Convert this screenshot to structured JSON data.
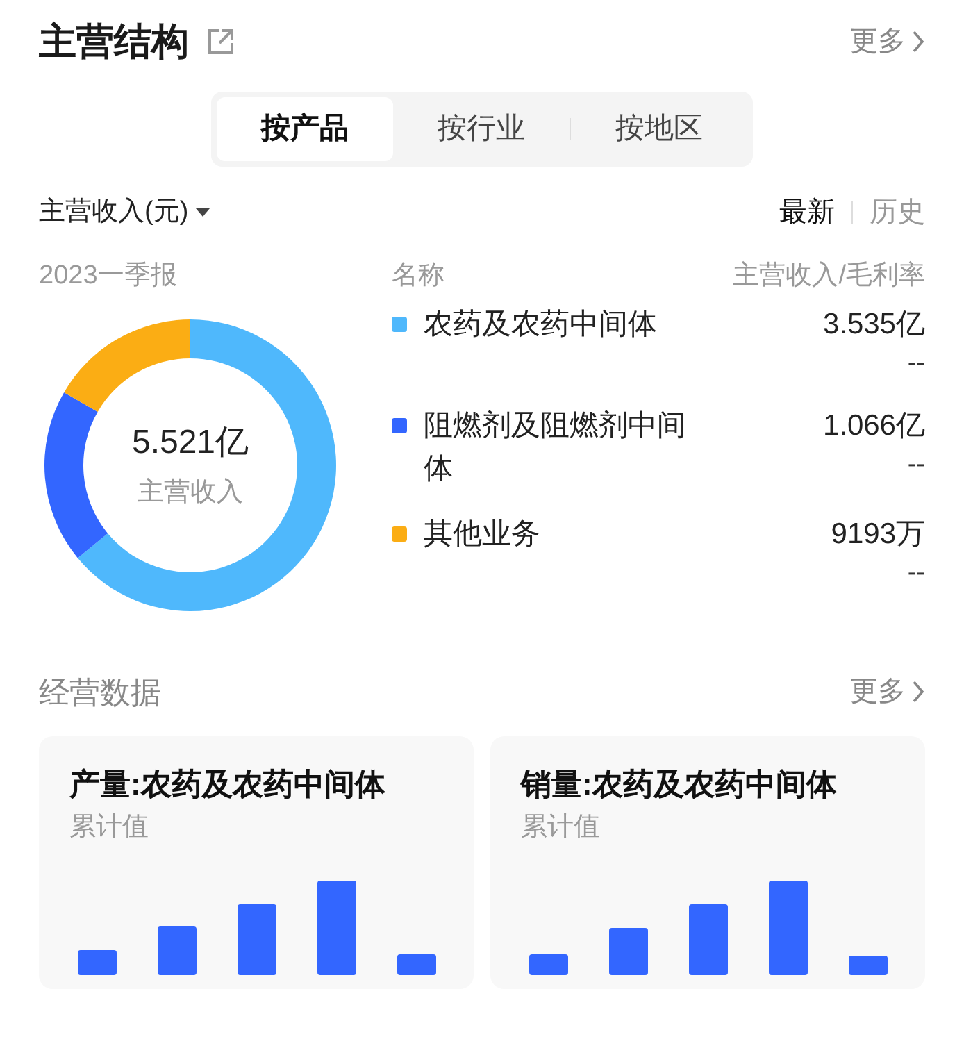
{
  "header": {
    "title": "主营结构",
    "more": "更多"
  },
  "tabs": [
    {
      "label": "按产品",
      "selected": true
    },
    {
      "label": "按行业",
      "selected": false
    },
    {
      "label": "按地区",
      "selected": false
    }
  ],
  "metric_dropdown": "主营收入(元)",
  "period_toggle": [
    {
      "label": "最新",
      "selected": true
    },
    {
      "label": "历史",
      "selected": false
    }
  ],
  "column_headers": {
    "period": "2023一季报",
    "name": "名称",
    "value": "主营收入/毛利率"
  },
  "donut": {
    "total": "5.521亿",
    "caption": "主营收入",
    "chart_data": {
      "type": "donut",
      "categories": [
        "农药及农药中间体",
        "阻燃剂及阻燃剂中间体",
        "其他业务"
      ],
      "values": [
        64.03,
        19.31,
        16.66
      ]
    }
  },
  "legend": [
    {
      "color": "#4fb8fc",
      "revenue": "3.535亿",
      "margin": "--"
    },
    {
      "color": "#3366ff",
      "revenue": "1.066亿",
      "margin": "--"
    },
    {
      "color": "#fbad14",
      "revenue": "9193万",
      "margin": "--"
    }
  ],
  "operations": {
    "title": "经营数据",
    "more": "更多"
  },
  "cards": [
    {
      "title": "产量:农药及农药中间体",
      "subtitle": "累计值",
      "kind": "picture"
    },
    {
      "title": "销量:农药及农药中间体",
      "subtitle": "累计值",
      "kind": "picture"
    }
  ]
}
